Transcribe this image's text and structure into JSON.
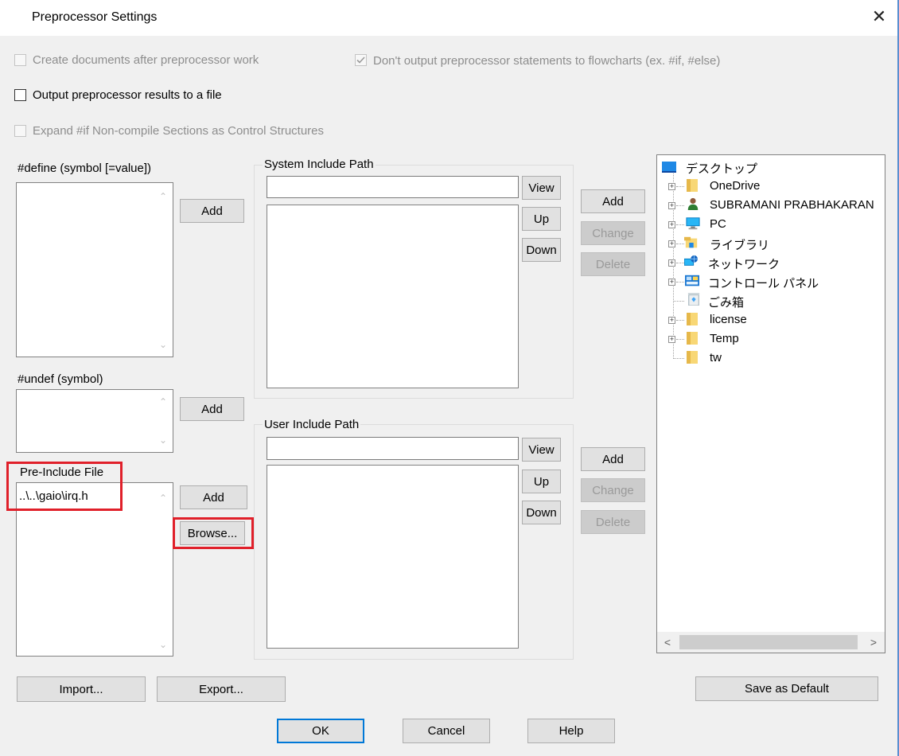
{
  "window": {
    "title": "Preprocessor Settings",
    "close_glyph": "✕"
  },
  "options": {
    "create_docs": {
      "label": "Create documents after preprocessor work",
      "checked": false,
      "enabled": false
    },
    "no_output_stmts": {
      "label": "Don't output preprocessor statements to flowcharts (ex. #if, #else)",
      "checked": true,
      "enabled": false
    },
    "output_to_file": {
      "label": "Output preprocessor results to a file",
      "checked": false,
      "enabled": true
    },
    "expand_if": {
      "label": "Expand #if Non-compile Sections as Control Structures",
      "checked": false,
      "enabled": false
    }
  },
  "define": {
    "label": "#define (symbol [=value])",
    "add": "Add",
    "items": []
  },
  "undef": {
    "label": "#undef (symbol)",
    "add": "Add",
    "items": []
  },
  "preinclude": {
    "label": "Pre-Include File",
    "add": "Add",
    "browse": "Browse...",
    "items": [
      "..\\..\\gaio\\irq.h"
    ]
  },
  "system_include": {
    "label": "System Include Path",
    "input_value": "",
    "view": "View",
    "up": "Up",
    "down": "Down",
    "add": "Add",
    "change": "Change",
    "delete": "Delete"
  },
  "user_include": {
    "label": "User Include Path",
    "input_value": "",
    "view": "View",
    "up": "Up",
    "down": "Down",
    "add": "Add",
    "change": "Change",
    "delete": "Delete"
  },
  "tree": {
    "items": [
      {
        "label": "デスクトップ",
        "icon": "desktop-icon"
      },
      {
        "label": "OneDrive",
        "icon": "folder-icon"
      },
      {
        "label": "SUBRAMANI PRABHAKARAN",
        "icon": "user-icon"
      },
      {
        "label": "PC",
        "icon": "computer-icon"
      },
      {
        "label": "ライブラリ",
        "icon": "library-icon"
      },
      {
        "label": "ネットワーク",
        "icon": "network-icon"
      },
      {
        "label": "コントロール パネル",
        "icon": "control-panel-icon"
      },
      {
        "label": "ごみ箱",
        "icon": "recycle-bin-icon"
      },
      {
        "label": "license",
        "icon": "folder-icon"
      },
      {
        "label": "Temp",
        "icon": "folder-icon"
      },
      {
        "label": "tw",
        "icon": "folder-icon"
      }
    ],
    "scroll_left": "<",
    "scroll_right": ">"
  },
  "footer": {
    "import": "Import...",
    "export": "Export...",
    "save_default": "Save as Default",
    "ok": "OK",
    "cancel": "Cancel",
    "help": "Help"
  },
  "colors": {
    "highlight": "#e0202a",
    "accent": "#0078d7"
  }
}
